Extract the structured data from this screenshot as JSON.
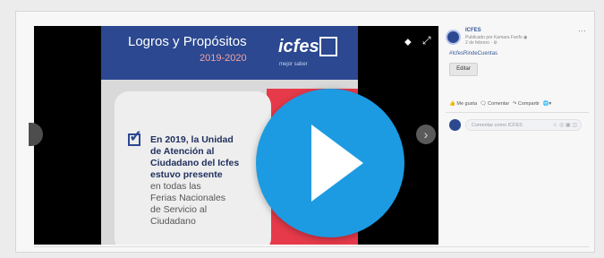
{
  "post": {
    "page_name": "ICFES",
    "meta_line1": "Publicado por Kamara Fanfo ◉",
    "meta_line2": "2 de febrero · ⚙",
    "more": "···",
    "hashtag": "#IcfesRindeCuentas",
    "edit_label": "Editar"
  },
  "actions": {
    "like": "👍 Me gusta",
    "comment": "🗨 Comentar",
    "share": "↷ Compartir",
    "audience": "🌐▾"
  },
  "comment": {
    "placeholder": "Comentar como ICFES",
    "icons": "☺ ◎ ▣ ◫"
  },
  "viewer": {
    "tag_icon": "⬥",
    "expand_icon": "⤢",
    "next_icon": "›"
  },
  "slide": {
    "title": "Logros y Propósitos",
    "years": "2019-2020",
    "logo_text": "icfes",
    "logo_sub": "mejor saber",
    "bold_lines": [
      "En 2019, la Unidad",
      "de Atención al",
      "Ciudadano del Icfes",
      "estuvo presente"
    ],
    "normal_lines": [
      "en todas las",
      "Ferias Nacionales",
      "de Servicio al",
      "Ciudadano"
    ]
  },
  "colors": {
    "brand_blue": "#2b4890",
    "accent_red": "#e63a4a",
    "play_blue": "#1d9be2"
  }
}
